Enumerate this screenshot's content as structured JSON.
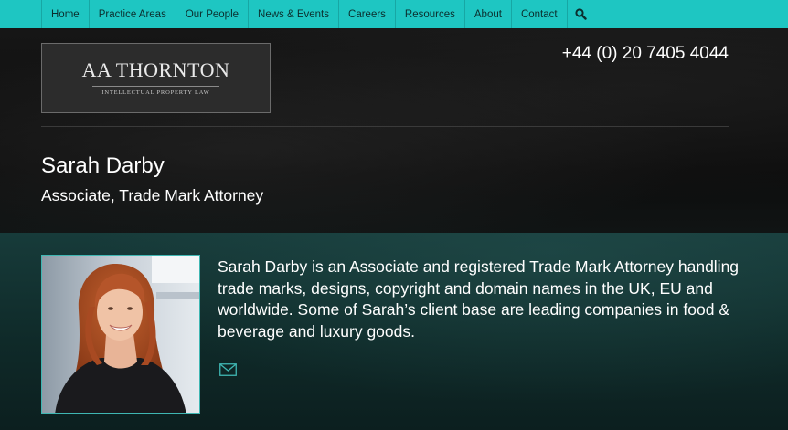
{
  "nav": {
    "items": [
      {
        "label": "Home"
      },
      {
        "label": "Practice Areas"
      },
      {
        "label": "Our People"
      },
      {
        "label": "News & Events"
      },
      {
        "label": "Careers"
      },
      {
        "label": "Resources"
      },
      {
        "label": "About"
      },
      {
        "label": "Contact"
      }
    ],
    "search_icon": "search-icon"
  },
  "header": {
    "logo": {
      "name": "AA THORNTON",
      "tagline": "INTELLECTUAL PROPERTY LAW"
    },
    "phone": "+44 (0) 20 7405 4044"
  },
  "profile": {
    "name": "Sarah Darby",
    "title": "Associate, Trade Mark Attorney",
    "bio": "Sarah Darby is an Associate and registered Trade Mark Attorney handling trade marks, designs, copyright and domain names in the UK, EU and worldwide. Some of Sarah’s client base are leading companies in food & beverage and luxury goods.",
    "email_icon": "envelope-icon"
  },
  "colors": {
    "nav_bg": "#1ec6c2",
    "accent": "#3fb7b3",
    "content_bg": "#173b3a"
  }
}
